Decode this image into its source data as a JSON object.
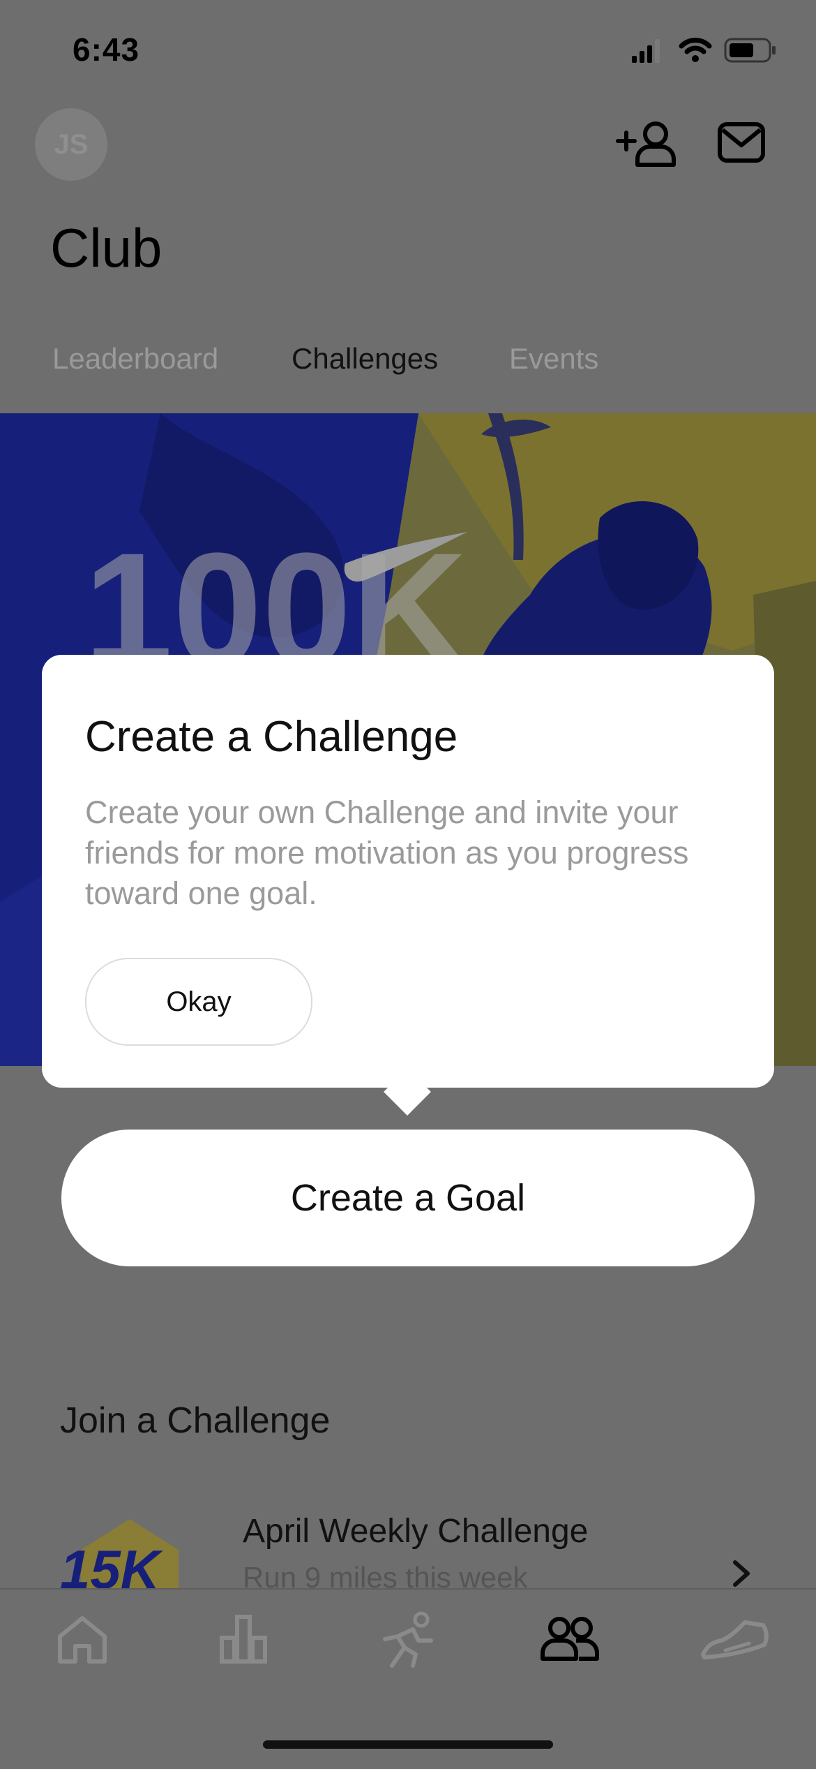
{
  "status_bar": {
    "time": "6:43"
  },
  "header": {
    "avatar_initials": "JS",
    "title": "Club"
  },
  "tabs": [
    {
      "label": "Leaderboard",
      "active": false
    },
    {
      "label": "Challenges",
      "active": true
    },
    {
      "label": "Events",
      "active": false
    }
  ],
  "popup": {
    "title": "Create a Challenge",
    "body": "Create your own Challenge and invite your friends for more motivation as you progress toward one goal.",
    "okay_label": "Okay"
  },
  "create_goal_label": "Create a Goal",
  "join": {
    "title": "Join a Challenge",
    "challenge": {
      "badge_text": "15K",
      "title": "April Weekly Challenge",
      "subtitle": "Run 9 miles this week"
    }
  },
  "tab_bar": {
    "items": [
      "home-icon",
      "activity-icon",
      "run-icon",
      "club-icon",
      "shoe-icon"
    ],
    "active": "club-icon"
  },
  "colors": {
    "overlay": "#6e6e6e",
    "hero_blue": "#16207a",
    "hero_yellow": "#7b7230",
    "text_dark": "#111111",
    "text_muted": "#9a9a9a"
  }
}
